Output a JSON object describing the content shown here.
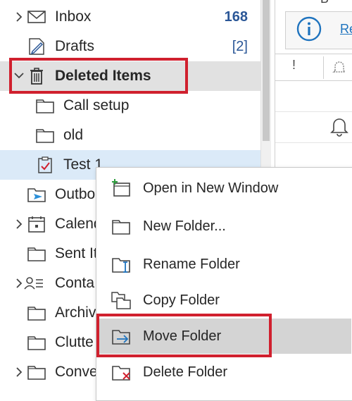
{
  "header": {
    "partial_text": "Б",
    "link_partial": "Re"
  },
  "folders": [
    {
      "label": "Inbox",
      "count": "168",
      "icon": "envelope-icon",
      "chevron": true
    },
    {
      "label": "Drafts",
      "count": "[2]",
      "icon": "drafts-pencil-icon",
      "chevron": false
    },
    {
      "label": "Deleted Items",
      "icon": "trash-icon",
      "chevron": true,
      "expanded": true
    },
    {
      "label": "Call setup",
      "icon": "folder-icon"
    },
    {
      "label": "old",
      "icon": "folder-icon"
    },
    {
      "label": "Test 1",
      "icon": "clipboard-check-icon"
    },
    {
      "label": "Outbo",
      "icon": "outbox-icon"
    },
    {
      "label": "Calend",
      "icon": "calendar-icon",
      "chevron": true
    },
    {
      "label": "Sent It",
      "icon": "folder-icon"
    },
    {
      "label": "Conta",
      "icon": "contacts-icon",
      "chevron": true
    },
    {
      "label": "Archiv",
      "icon": "folder-icon"
    },
    {
      "label": "Clutte",
      "icon": "folder-icon"
    },
    {
      "label": "Conve",
      "icon": "folder-icon",
      "chevron": true
    }
  ],
  "context_menu": [
    {
      "label": "Open in New Window",
      "icon": "open-new-window-icon"
    },
    {
      "label": "New Folder...",
      "icon": "new-folder-icon"
    },
    {
      "label": "Rename Folder",
      "icon": "rename-folder-icon"
    },
    {
      "label": "Copy Folder",
      "icon": "copy-folder-icon"
    },
    {
      "label": "Move Folder",
      "icon": "move-folder-icon",
      "highlighted": true
    },
    {
      "label": "Delete Folder",
      "icon": "delete-folder-icon"
    }
  ],
  "message_pane": {
    "column_headers": [
      "!",
      "reminder-bell-icon"
    ]
  },
  "colors": {
    "annotation": "#d0202e",
    "count": "#2b5797",
    "info_icon": "#1e73be"
  }
}
